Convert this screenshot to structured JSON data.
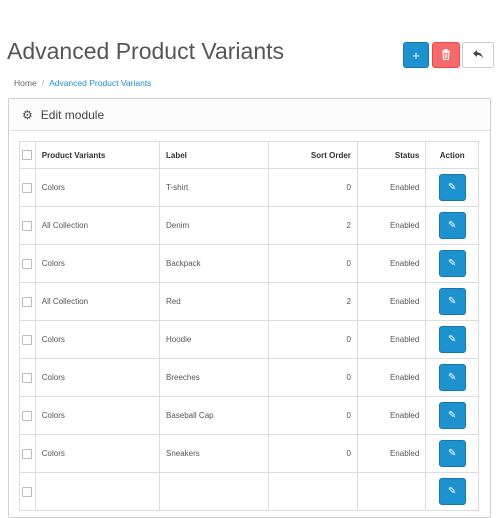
{
  "header": {
    "title": "Advanced Product Variants",
    "buttons": [
      {
        "name": "add",
        "icon": "plus-icon",
        "glyph": "+"
      },
      {
        "name": "delete",
        "icon": "trash-icon",
        "glyph": "🗑"
      },
      {
        "name": "back",
        "icon": "reply-icon",
        "glyph": "↶"
      }
    ]
  },
  "breadcrumb": {
    "items": [
      "Home",
      "Advanced Product Variants"
    ],
    "separator": "/"
  },
  "panel": {
    "icon": "gear-icon",
    "icon_glyph": "⚙",
    "title": "Edit module"
  },
  "table": {
    "columns": {
      "product_variants": "Product Variants",
      "label": "Label",
      "sort_order": "Sort Order",
      "status": "Status",
      "action": "Action"
    },
    "edit_glyph": "✎",
    "rows": [
      {
        "product_variants": "Colors",
        "label": "T-shirt",
        "sort_order": "0",
        "status": "Enabled"
      },
      {
        "product_variants": "All Collection",
        "label": "Denim",
        "sort_order": "2",
        "status": "Enabled"
      },
      {
        "product_variants": "Colors",
        "label": "Backpack",
        "sort_order": "0",
        "status": "Enabled"
      },
      {
        "product_variants": "All Collection",
        "label": "Red",
        "sort_order": "2",
        "status": "Enabled"
      },
      {
        "product_variants": "Colors",
        "label": "Hoodie",
        "sort_order": "0",
        "status": "Enabled"
      },
      {
        "product_variants": "Colors",
        "label": "Breeches",
        "sort_order": "0",
        "status": "Enabled"
      },
      {
        "product_variants": "Colors",
        "label": "Baseball Cap",
        "sort_order": "0",
        "status": "Enabled"
      },
      {
        "product_variants": "Colors",
        "label": "Sneakers",
        "sort_order": "0",
        "status": "Enabled"
      },
      {
        "product_variants": "",
        "label": "",
        "sort_order": "",
        "status": ""
      }
    ]
  },
  "colors": {
    "primary": "#1e91cf",
    "danger": "#f56b6b"
  }
}
